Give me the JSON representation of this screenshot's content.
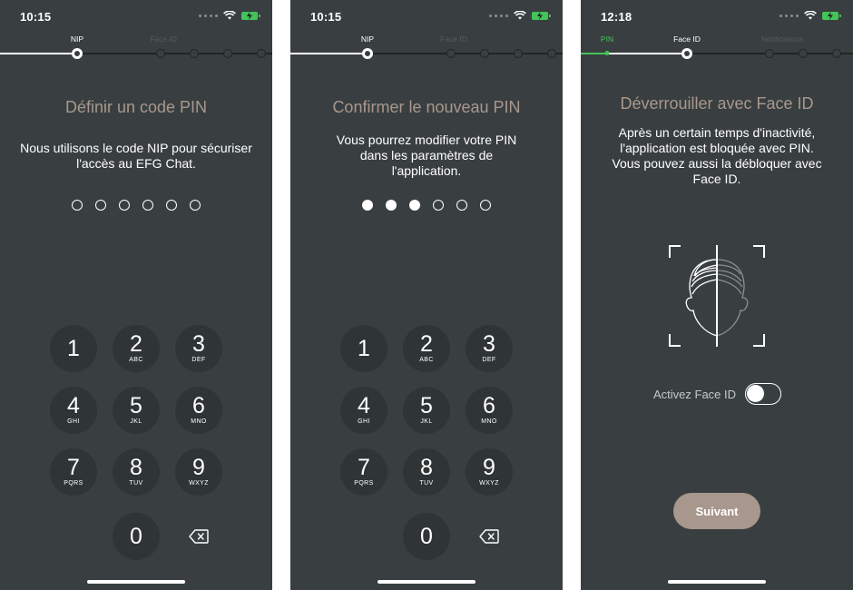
{
  "screens": [
    {
      "time": "10:15",
      "steps": [
        "NIP",
        "Face ID"
      ],
      "title": "Définir un code PIN",
      "description": "Nous utilisons le code NIP pour sécuriser l'accès au EFG Chat.",
      "pin_filled": 0,
      "pin_length": 6
    },
    {
      "time": "10:15",
      "steps": [
        "NIP",
        "Face ID"
      ],
      "title": "Confirmer le nouveau PIN",
      "description": "Vous pourrez modifier votre PIN dans les paramètres de l'application.",
      "pin_filled": 3,
      "pin_length": 6
    },
    {
      "time": "12:18",
      "steps": [
        "PIN",
        "Face ID",
        "Notifications"
      ],
      "title": "Déverrouiller avec Face ID",
      "description": "Après un certain temps d'inactivité, l'application est bloquée avec PIN. Vous pouvez aussi la débloquer avec Face ID.",
      "toggle_label": "Activez Face ID",
      "toggle_on": false,
      "next_label": "Suivant"
    }
  ],
  "keypad": [
    {
      "num": "1",
      "letters": ""
    },
    {
      "num": "2",
      "letters": "ABC"
    },
    {
      "num": "3",
      "letters": "DEF"
    },
    {
      "num": "4",
      "letters": "GHI"
    },
    {
      "num": "5",
      "letters": "JKL"
    },
    {
      "num": "6",
      "letters": "MNO"
    },
    {
      "num": "7",
      "letters": "PQRS"
    },
    {
      "num": "8",
      "letters": "TUV"
    },
    {
      "num": "9",
      "letters": "WXYZ"
    },
    {
      "num": "0",
      "letters": ""
    }
  ],
  "icons": {
    "clear": "backspace-icon",
    "face": "face-id-icon",
    "wifi": "wifi-icon",
    "battery": "battery-charging-icon"
  },
  "colors": {
    "background": "#393f40",
    "accent": "#a8978d",
    "success": "#43c35a",
    "key": "#2f3435"
  }
}
